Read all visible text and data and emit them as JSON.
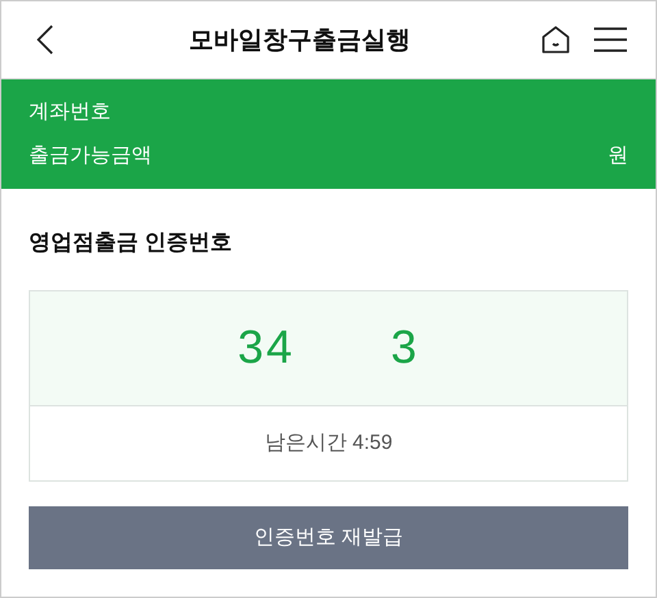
{
  "header": {
    "title": "모바일창구출금실행"
  },
  "account": {
    "account_label": "계좌번호",
    "balance_label": "출금가능금액",
    "balance_unit": "원"
  },
  "auth": {
    "title": "영업점출금 인증번호",
    "code_parts": [
      "34",
      "3"
    ],
    "timer": "남은시간 4:59",
    "reissue_button": "인증번호 재발급"
  }
}
